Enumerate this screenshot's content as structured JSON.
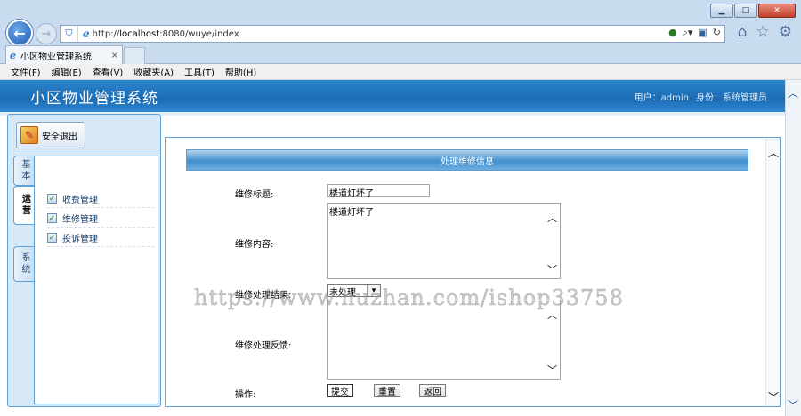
{
  "browser": {
    "address": {
      "scheme": "http://",
      "host": "localhost",
      "path": ":8080/wuye/index",
      "search_icon": "search-icon",
      "refresh_icon": "refresh-icon"
    },
    "tab": {
      "title": "小区物业管理系统",
      "close_glyph": "×"
    },
    "menu": [
      "文件(F)",
      "编辑(E)",
      "查看(V)",
      "收藏夹(A)",
      "工具(T)",
      "帮助(H)"
    ],
    "window_buttons": {
      "minimize": "▁",
      "maximize": "□",
      "close": "✕"
    }
  },
  "app": {
    "title": "小区物业管理系统",
    "user_label": "用户：",
    "user_value": "admin",
    "role_label": "身份：",
    "role_value": "系统管理员"
  },
  "sidebar": {
    "logout_label": "安全退出",
    "tabs": [
      {
        "label": "基本"
      },
      {
        "label": "运营"
      },
      {
        "label": "系统"
      }
    ],
    "items": [
      {
        "label": "收费管理"
      },
      {
        "label": "维修管理"
      },
      {
        "label": "投诉管理"
      }
    ]
  },
  "form": {
    "header": "处理维修信息",
    "title_label": "维修标题:",
    "title_value": "楼道灯坏了",
    "content_label": "维修内容:",
    "content_value": "楼道灯坏了",
    "result_label": "维修处理结果:",
    "result_value": "未处理",
    "feedback_label": "维修处理反馈:",
    "feedback_value": "",
    "action_label": "操作:",
    "submit_label": "提交",
    "reset_label": "重置",
    "back_label": "返回"
  },
  "watermark": "https://www.huzhan.com/ishop33758"
}
